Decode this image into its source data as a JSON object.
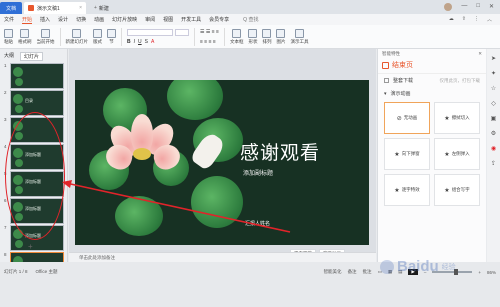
{
  "titlebar": {
    "home_label": "文档",
    "doc_tab": "演示文稿1",
    "new_tab": "新建",
    "window_controls": [
      "—",
      "□",
      "✕"
    ]
  },
  "menubar": {
    "items": [
      "文件",
      "开始",
      "插入",
      "设计",
      "切换",
      "动画",
      "幻灯片放映",
      "审阅",
      "视图",
      "开发工具",
      "会员专享"
    ],
    "active_index": 1,
    "search_label": "Q 查找"
  },
  "ribbon": {
    "buttons": [
      "粘贴",
      "格式刷",
      "当前开始",
      "新建幻灯片",
      "版式",
      "节",
      "文本框",
      "形状",
      "排列",
      "图片",
      "演示工具"
    ]
  },
  "leftpanel": {
    "tabs": [
      "大纲",
      "幻灯片"
    ],
    "active_tab": 1,
    "slides": [
      {
        "num": "1",
        "title": ""
      },
      {
        "num": "2",
        "title": "目录"
      },
      {
        "num": "3",
        "title": ""
      },
      {
        "num": "4",
        "title": "添加标题"
      },
      {
        "num": "5",
        "title": "添加标题"
      },
      {
        "num": "6",
        "title": "添加标题"
      },
      {
        "num": "7",
        "title": "添加标题"
      },
      {
        "num": "8",
        "title": ""
      }
    ]
  },
  "slide": {
    "title": "感谢观看",
    "subtitle": "添加副标题",
    "author": "汇报人姓名"
  },
  "float_buttons": {
    "download": "墨宝下载",
    "animation": "演示动画"
  },
  "notes": {
    "placeholder": "单击此处添加备注"
  },
  "rightpanel": {
    "header": "智能特性",
    "title": "结束页",
    "row1_label": "整套下载",
    "row1_hint": "仅用此页，打包下载",
    "row2_label": "演示动画",
    "animations": [
      "无动画",
      "擦拭切入",
      "向下弹窗",
      "左侧弹入",
      "逐字特效",
      "组合写字"
    ],
    "selected_animation": 0
  },
  "statusbar": {
    "slide_info": "幻灯片 1 / 8",
    "theme": "Office 主题",
    "smart_beautify": "智能美化",
    "notes_btn": "备注",
    "comments_btn": "批注",
    "zoom": "86%"
  },
  "colors": {
    "accent": "#e8572d",
    "slide_bg": "#173123",
    "annotation_red": "#e0242a"
  }
}
